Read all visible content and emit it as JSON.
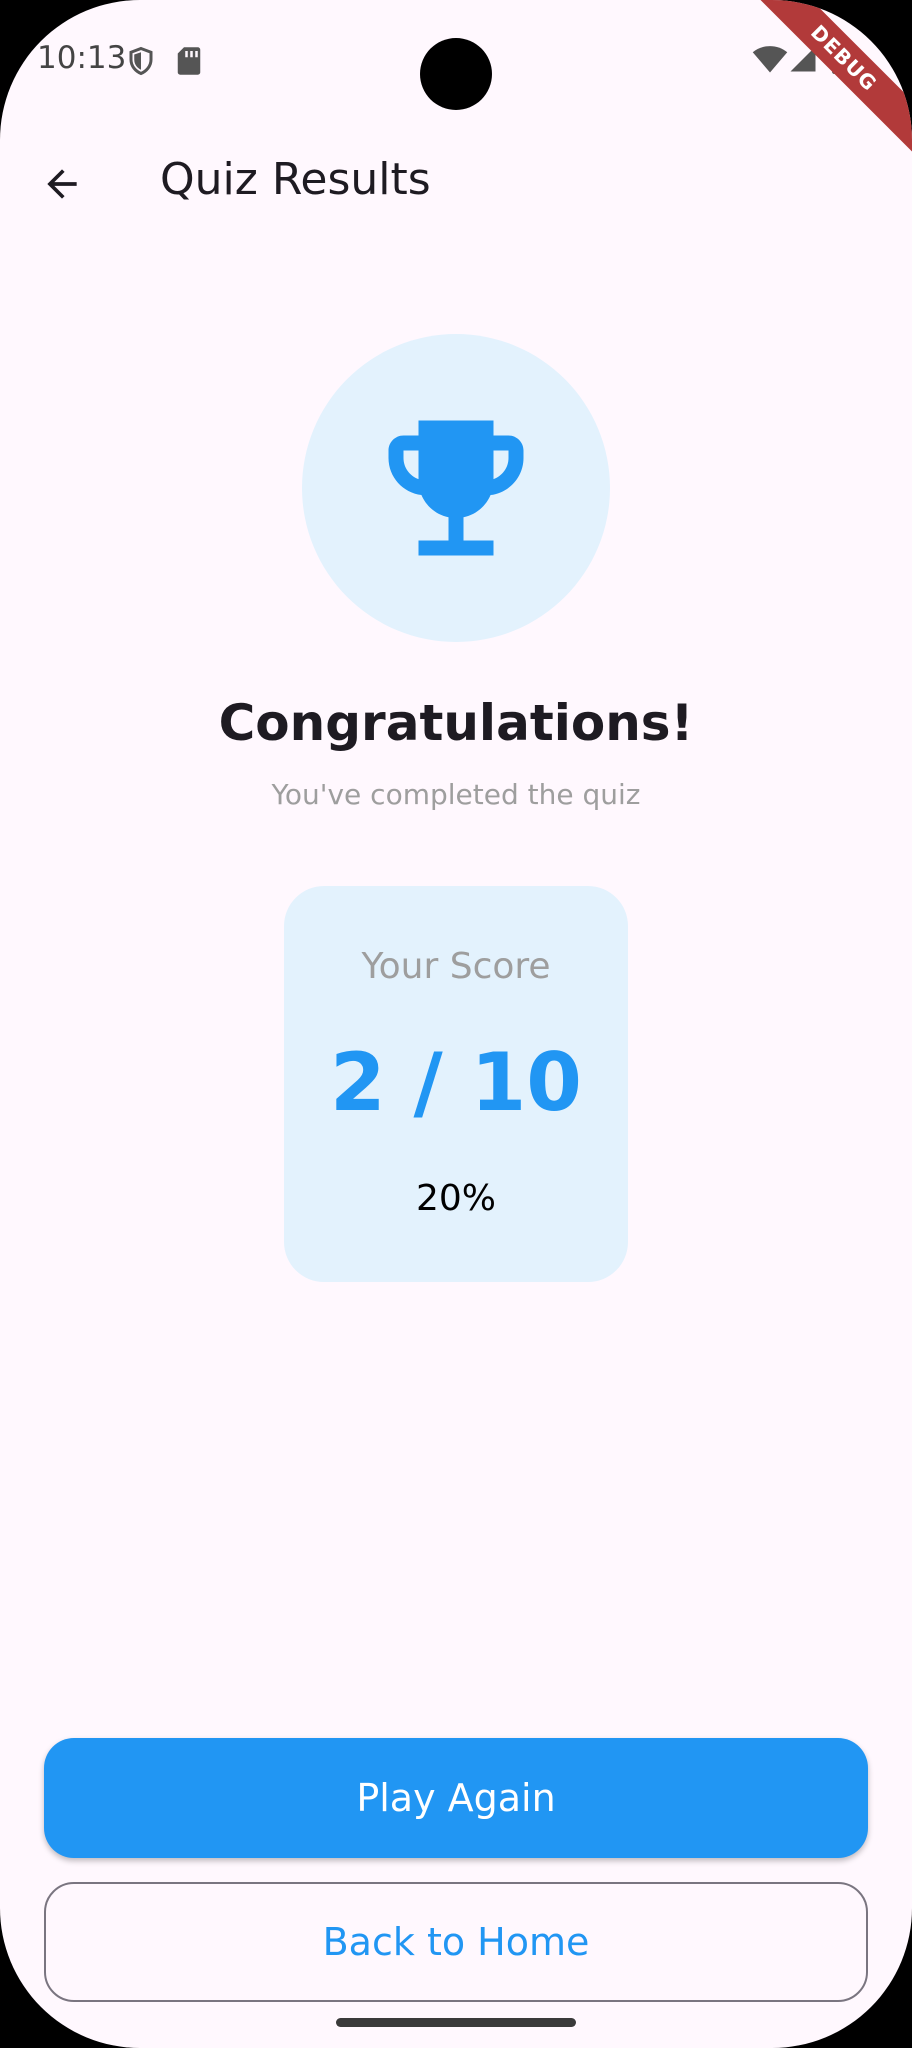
{
  "status_bar": {
    "time": "10:13"
  },
  "debug_banner": {
    "label": "DEBUG"
  },
  "app_bar": {
    "title": "Quiz Results"
  },
  "result": {
    "title": "Congratulations!",
    "subtitle": "You've completed the quiz"
  },
  "score": {
    "label": "Your Score",
    "value": "2 / 10",
    "percent": "20%"
  },
  "buttons": {
    "play_again": "Play Again",
    "back_home": "Back to Home"
  },
  "colors": {
    "accent": "#2196F3",
    "card_background": "#E3F2FD",
    "page_background": "#FFF8FE"
  },
  "icons": {
    "back": "arrow-back-icon",
    "trophy": "trophy-icon"
  }
}
